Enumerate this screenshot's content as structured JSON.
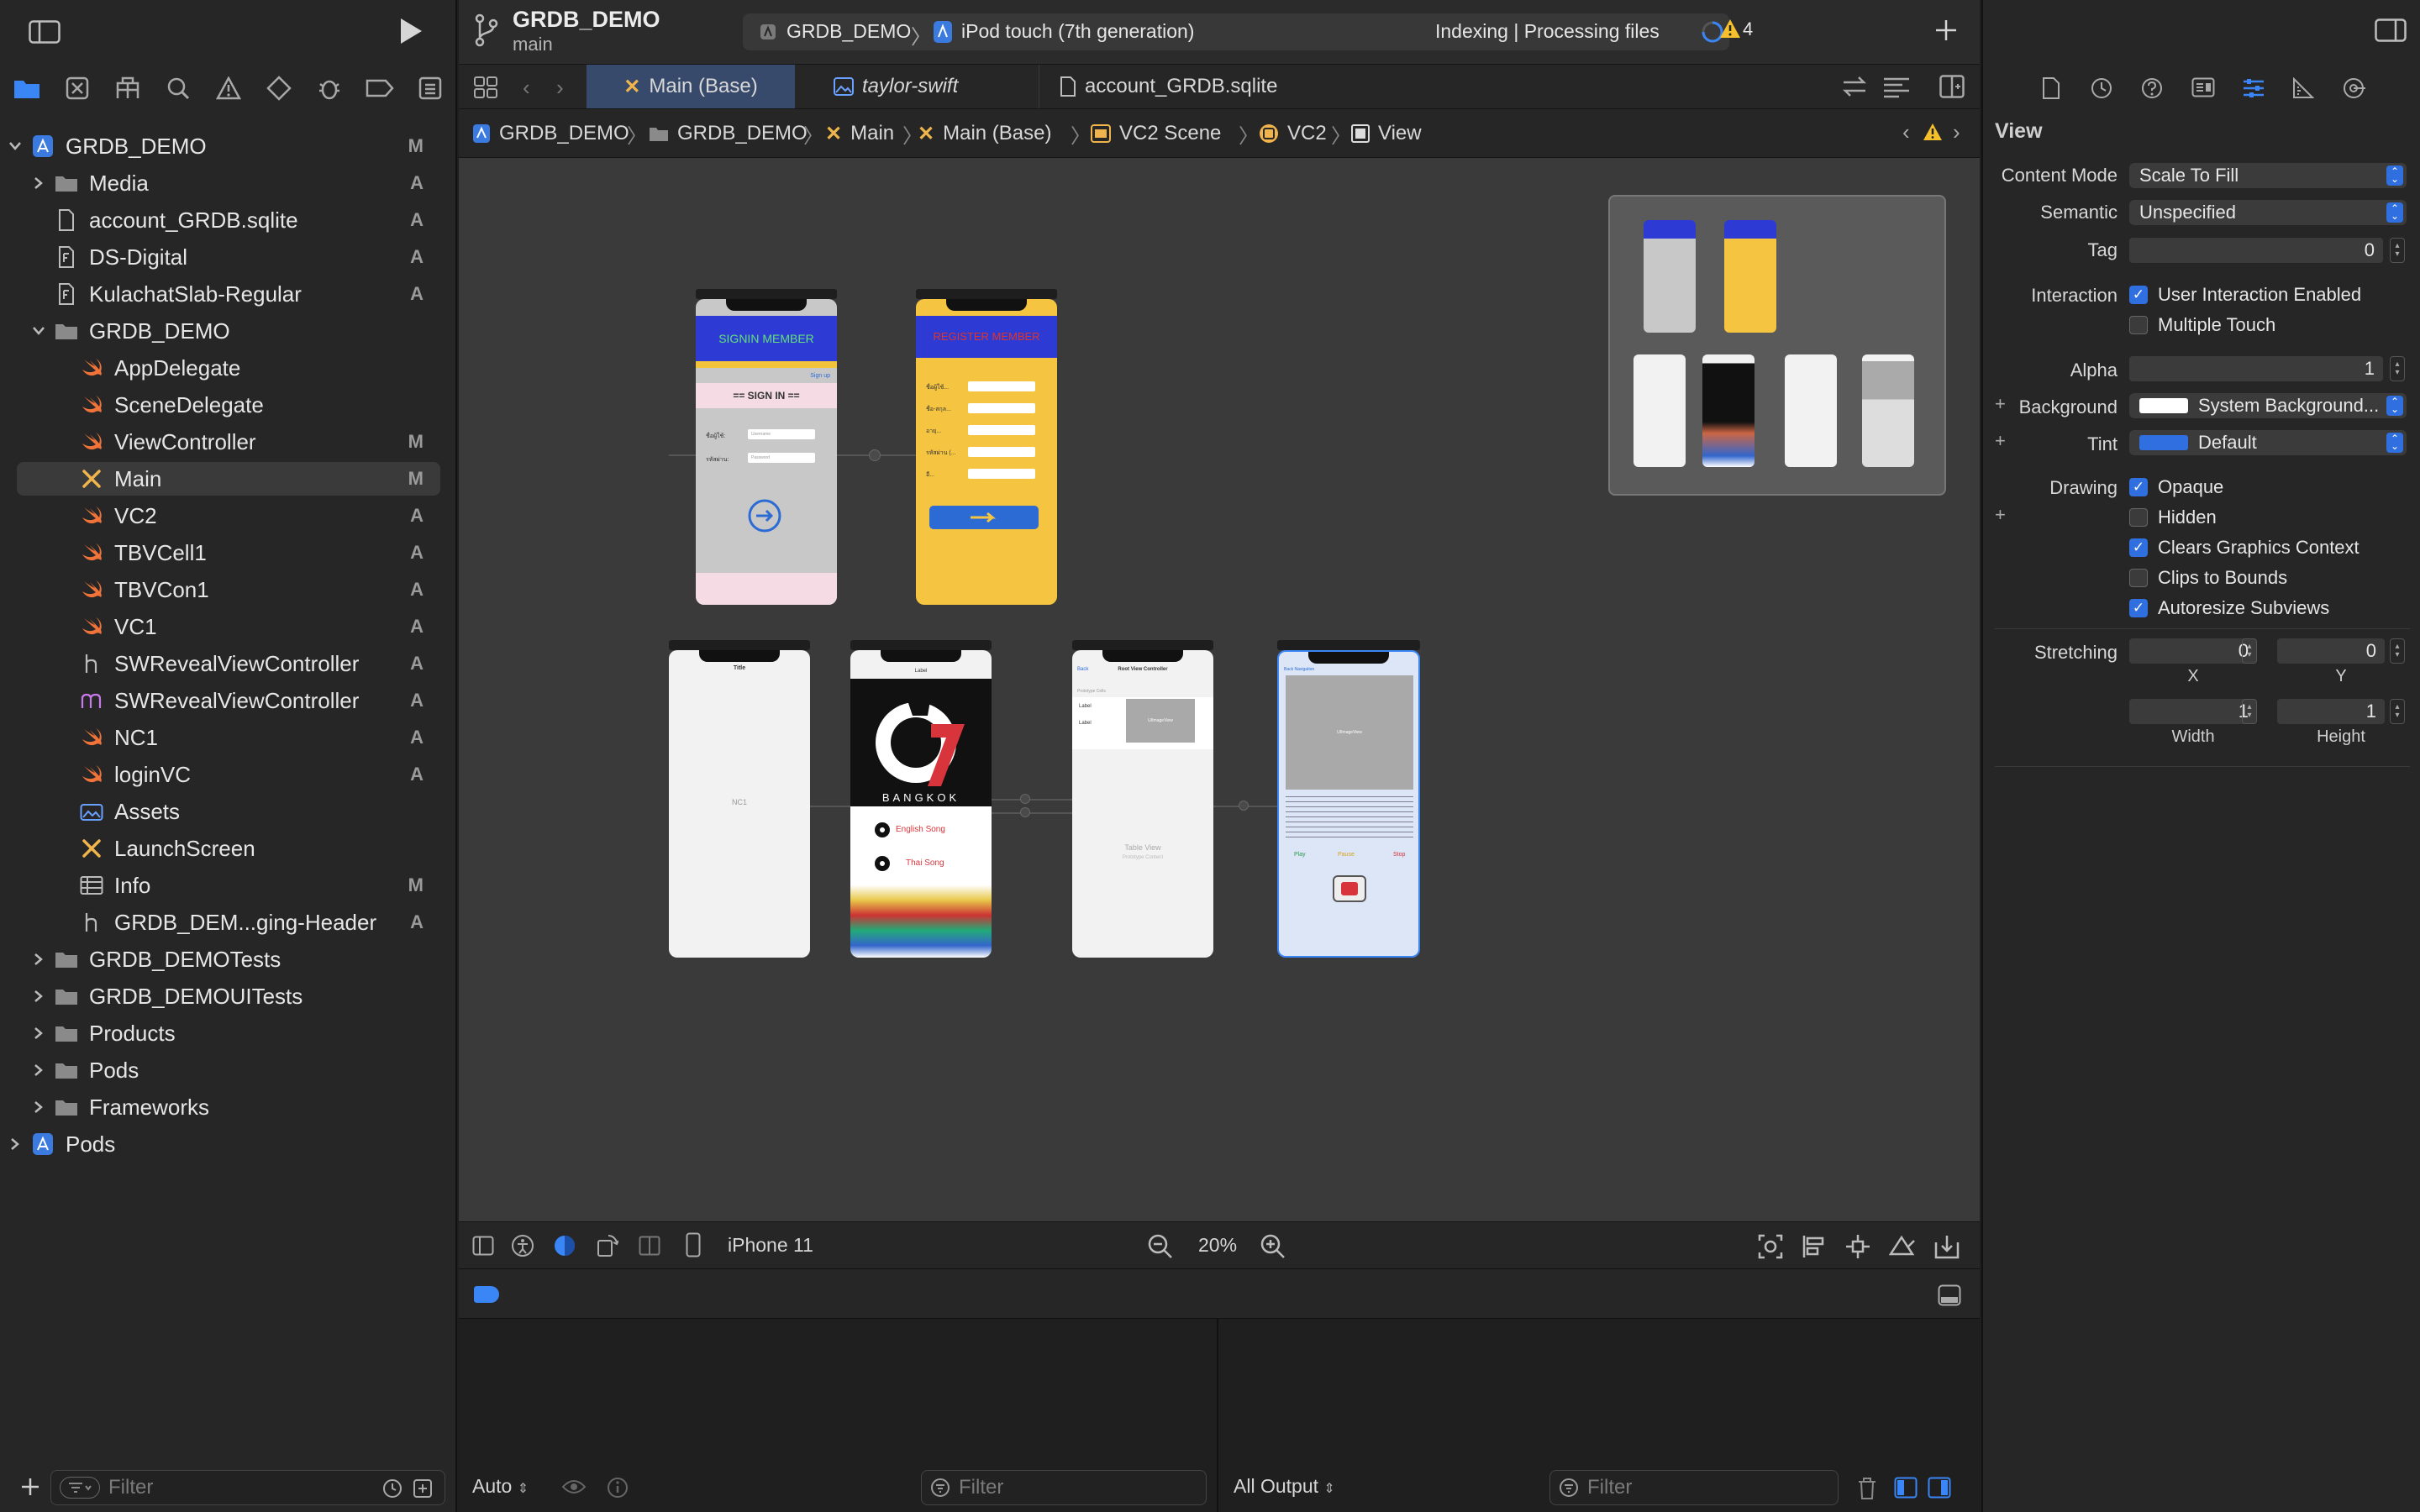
{
  "navigator": {
    "tabs": [
      "project-navigator-icon",
      "source-control-icon",
      "symbol-navigator-icon",
      "find-icon",
      "issue-icon",
      "test-icon",
      "debug-icon",
      "breakpoint-icon",
      "report-icon"
    ],
    "filter_placeholder": "Filter",
    "tree": [
      {
        "label": "GRDB_DEMO",
        "status": "M",
        "icon": "project-icon",
        "indent": 0,
        "disclosure": "open"
      },
      {
        "label": "Media",
        "status": "A",
        "icon": "folder-icon",
        "indent": 1,
        "disclosure": "closed"
      },
      {
        "label": "account_GRDB.sqlite",
        "status": "A",
        "icon": "file-icon",
        "indent": 1,
        "disclosure": "none"
      },
      {
        "label": "DS-Digital",
        "status": "A",
        "icon": "font-file-icon",
        "indent": 1,
        "disclosure": "none"
      },
      {
        "label": "KulachatSlab-Regular",
        "status": "A",
        "icon": "font-file-icon",
        "indent": 1,
        "disclosure": "none"
      },
      {
        "label": "GRDB_DEMO",
        "status": "",
        "icon": "folder-icon",
        "indent": 1,
        "disclosure": "open"
      },
      {
        "label": "AppDelegate",
        "status": "",
        "icon": "swift-icon",
        "indent": 2,
        "disclosure": "none"
      },
      {
        "label": "SceneDelegate",
        "status": "",
        "icon": "swift-icon",
        "indent": 2,
        "disclosure": "none"
      },
      {
        "label": "ViewController",
        "status": "M",
        "icon": "swift-icon",
        "indent": 2,
        "disclosure": "none"
      },
      {
        "label": "Main",
        "status": "M",
        "icon": "storyboard-icon",
        "indent": 2,
        "disclosure": "none",
        "selected": true
      },
      {
        "label": "VC2",
        "status": "A",
        "icon": "swift-icon",
        "indent": 2,
        "disclosure": "none"
      },
      {
        "label": "TBVCell1",
        "status": "A",
        "icon": "swift-icon",
        "indent": 2,
        "disclosure": "none"
      },
      {
        "label": "TBVCon1",
        "status": "A",
        "icon": "swift-icon",
        "indent": 2,
        "disclosure": "none"
      },
      {
        "label": "VC1",
        "status": "A",
        "icon": "swift-icon",
        "indent": 2,
        "disclosure": "none"
      },
      {
        "label": "SWRevealViewController",
        "status": "A",
        "icon": "header-file-icon",
        "indent": 2,
        "disclosure": "none"
      },
      {
        "label": "SWRevealViewController",
        "status": "A",
        "icon": "objc-file-icon",
        "indent": 2,
        "disclosure": "none"
      },
      {
        "label": "NC1",
        "status": "A",
        "icon": "swift-icon",
        "indent": 2,
        "disclosure": "none"
      },
      {
        "label": "loginVC",
        "status": "A",
        "icon": "swift-icon",
        "indent": 2,
        "disclosure": "none"
      },
      {
        "label": "Assets",
        "status": "",
        "icon": "assets-icon",
        "indent": 2,
        "disclosure": "none"
      },
      {
        "label": "LaunchScreen",
        "status": "",
        "icon": "storyboard-icon",
        "indent": 2,
        "disclosure": "none"
      },
      {
        "label": "Info",
        "status": "M",
        "icon": "plist-icon",
        "indent": 2,
        "disclosure": "none"
      },
      {
        "label": "GRDB_DEM...ging-Header",
        "status": "A",
        "icon": "header-file-icon",
        "indent": 2,
        "disclosure": "none"
      },
      {
        "label": "GRDB_DEMOTests",
        "status": "",
        "icon": "folder-icon",
        "indent": 1,
        "disclosure": "closed"
      },
      {
        "label": "GRDB_DEMOUITests",
        "status": "",
        "icon": "folder-icon",
        "indent": 1,
        "disclosure": "closed"
      },
      {
        "label": "Products",
        "status": "",
        "icon": "folder-icon",
        "indent": 1,
        "disclosure": "closed"
      },
      {
        "label": "Pods",
        "status": "",
        "icon": "folder-icon",
        "indent": 1,
        "disclosure": "closed"
      },
      {
        "label": "Frameworks",
        "status": "",
        "icon": "folder-icon",
        "indent": 1,
        "disclosure": "closed"
      },
      {
        "label": "Pods",
        "status": "",
        "icon": "project-icon",
        "indent": 0,
        "disclosure": "closed"
      }
    ]
  },
  "toolbar": {
    "project": "GRDB_DEMO",
    "branch": "main",
    "scheme": "GRDB_DEMO",
    "destination": "iPod touch (7th generation)",
    "activity": "Indexing | Processing files",
    "warnings": "4"
  },
  "tabs": [
    {
      "label": "Main (Base)",
      "icon": "storyboard-icon",
      "active": true
    },
    {
      "label": "taylor-swift",
      "icon": "image-icon",
      "active": false
    },
    {
      "label": "account_GRDB.sqlite",
      "icon": "file-icon",
      "active": false
    }
  ],
  "breadcrumbs": [
    "GRDB_DEMO",
    "GRDB_DEMO",
    "Main",
    "Main (Base)",
    "VC2 Scene",
    "VC2",
    "View"
  ],
  "canvas": {
    "device": "iPhone 11",
    "zoom": "20%",
    "scenes": {
      "login": {
        "title": "SIGNIN MEMBER",
        "heading": "== SIGN IN ==",
        "link": "Sign up",
        "field1": "ชื่อผู้ใช้:",
        "field2": "รหัสผ่าน:",
        "field1_ph": "Username",
        "field2_ph": "Password"
      },
      "register": {
        "title": "REGISTER MEMBER",
        "rows": [
          "ชื่อผู้ใช้...",
          "ชื่อ-สกุล...",
          "อายุ...",
          "รหัสผ่าน (...",
          "อี..."
        ]
      },
      "nc1": {
        "title": "Title",
        "center": "NC1"
      },
      "vc1": {
        "top": "Label",
        "brand": "BANGKOK",
        "item1": "English Song",
        "item2": "Thai Song"
      },
      "root": {
        "title": "Root View Controller",
        "back": "Back",
        "proto": "Prototype Cells",
        "label1": "Label",
        "label2": "Label",
        "img": "UIImageView",
        "table": "Table View",
        "table_sub": "Prototype Content"
      },
      "vc2": {
        "back": "Back Navigation",
        "img": "UIImageView",
        "play": "Play",
        "pause": "Pause",
        "stop": "Stop"
      }
    }
  },
  "debug": {
    "auto": "Auto",
    "filter_left": "Filter",
    "output": "All Output",
    "filter_right": "Filter"
  },
  "inspector": {
    "section": "View",
    "content_mode_label": "Content Mode",
    "content_mode": "Scale To Fill",
    "semantic_label": "Semantic",
    "semantic": "Unspecified",
    "tag_label": "Tag",
    "tag": "0",
    "interaction_label": "Interaction",
    "user_interaction": "User Interaction Enabled",
    "multiple_touch": "Multiple Touch",
    "alpha_label": "Alpha",
    "alpha": "1",
    "background_label": "Background",
    "background": "System Background...",
    "tint_label": "Tint",
    "tint": "Default",
    "drawing_label": "Drawing",
    "opaque": "Opaque",
    "hidden": "Hidden",
    "clears": "Clears Graphics Context",
    "clips": "Clips to Bounds",
    "autoresize": "Autoresize Subviews",
    "stretching_label": "Stretching",
    "sx": "0",
    "sy": "0",
    "sw": "1",
    "sh": "1",
    "x_label": "X",
    "y_label": "Y",
    "w_label": "Width",
    "h_label": "Height",
    "accent": "#2f6fe0"
  }
}
